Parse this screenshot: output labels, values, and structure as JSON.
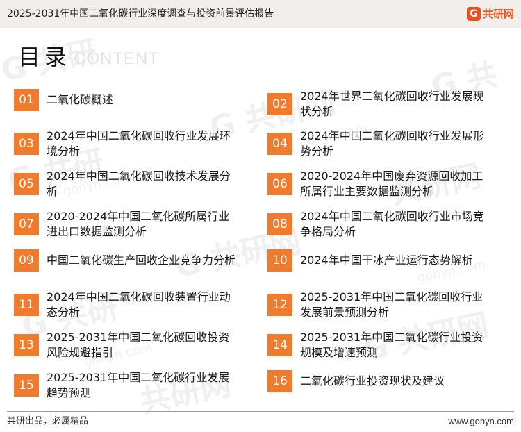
{
  "header": {
    "title": "2025-2031年中国二氧化碳行业深度调查与投资前景评估报告",
    "brand_logo_glyph": "G",
    "brand_name": "共研网"
  },
  "toc": {
    "title": "目录",
    "subtitle": "CONTENT",
    "items": [
      {
        "num": "01",
        "label": "二氧化碳概述"
      },
      {
        "num": "02",
        "label": "2024年世界二氧化碳回收行业发展现状分析"
      },
      {
        "num": "03",
        "label": "2024年中国二氧化碳回收行业发展环境分析"
      },
      {
        "num": "04",
        "label": "2024年中国二氧化碳回收行业发展形势分析"
      },
      {
        "num": "05",
        "label": "2024年中国二氧化碳回收技术发展分析"
      },
      {
        "num": "06",
        "label": "2020-2024年中国废弃资源回收加工所属行业主要数据监测分析"
      },
      {
        "num": "07",
        "label": "2020-2024年中国二氧化碳所属行业进出口数据监测分析"
      },
      {
        "num": "08",
        "label": "2024年中国二氧化碳回收行业市场竞争格局分析"
      },
      {
        "num": "09",
        "label": "中国二氧化碳生产回收企业竞争力分析"
      },
      {
        "num": "10",
        "label": "2024年中国干冰产业运行态势解析"
      },
      {
        "num": "11",
        "label": "2024年中国二氧化碳回收装置行业动态分析"
      },
      {
        "num": "12",
        "label": "2025-2031年中国二氧化碳回收行业发展前景预测分析"
      },
      {
        "num": "13",
        "label": "2025-2031年中国二氧化碳回收投资风险规避指引"
      },
      {
        "num": "14",
        "label": "2025-2031年中国二氧化碳行业投资规模及增速预测"
      },
      {
        "num": "15",
        "label": "2025-2031年中国二氧化碳行业发展趋势预测"
      },
      {
        "num": "16",
        "label": "二氧化碳行业投资现状及建议"
      }
    ]
  },
  "footer": {
    "slogan": "共研出品，必属精品",
    "url": "www.gonyn.com"
  },
  "colors": {
    "accent": "#f07b2d",
    "brand": "#e8501e",
    "header_bg": "#f1eeec"
  }
}
